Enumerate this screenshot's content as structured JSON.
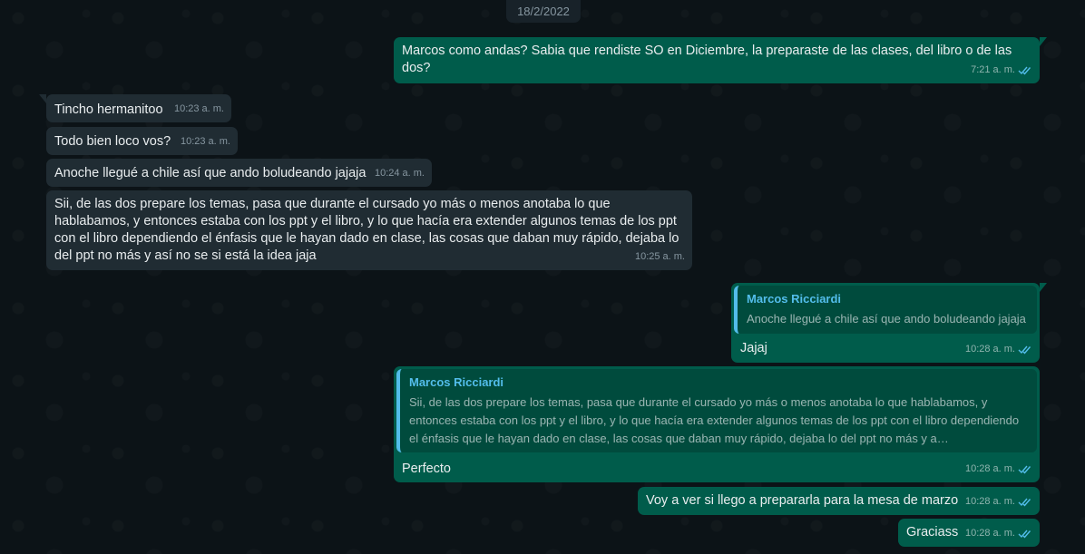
{
  "date": "18/2/2022",
  "colors": {
    "background": "#0c1317",
    "incoming_bubble": "#202c33",
    "outgoing_bubble": "#005c4b",
    "quote_accent": "#53bdeb",
    "read_ticks": "#53bdeb"
  },
  "messages": {
    "m1": {
      "text": "Marcos como andas? Sabia que rendiste SO en Diciembre, la preparaste de las clases, del libro o de las dos?",
      "time": "7:21 a. m."
    },
    "m2": {
      "text": "Tincho hermanitoo",
      "time": "10:23 a. m."
    },
    "m3": {
      "text": "Todo bien loco vos?",
      "time": "10:23 a. m."
    },
    "m4": {
      "text": "Anoche llegué a chile así que ando boludeando jajaja",
      "time": "10:24 a. m."
    },
    "m5": {
      "text": "Sii, de las dos prepare los temas, pasa que durante el cursado yo más o menos anotaba lo que hablabamos, y entonces estaba con los ppt y el libro, y lo que hacía era extender algunos temas de los ppt con el libro dependiendo el énfasis que le hayan dado en clase, las cosas que daban muy rápido, dejaba lo del ppt no más y así no se si está la idea jaja",
      "time": "10:25 a. m."
    },
    "m6": {
      "quote_author": "Marcos Ricciardi",
      "quote_text": "Anoche llegué a chile así que ando boludeando jajaja",
      "text": "Jajaj",
      "time": "10:28 a. m."
    },
    "m7": {
      "quote_author": "Marcos Ricciardi",
      "quote_text": "Sii, de las dos prepare los temas, pasa que durante el cursado yo más o menos anotaba lo que hablabamos, y entonces estaba con los ppt y el libro, y lo que hacía era extender algunos temas de los ppt con el libro dependiendo el énfasis que le hayan dado en clase, las cosas que daban muy rápido, dejaba lo del ppt no más y a…",
      "text": "Perfecto",
      "time": "10:28 a. m."
    },
    "m8": {
      "text": "Voy a ver si llego a prepararla para la mesa de marzo",
      "time": "10:28 a. m."
    },
    "m9": {
      "text": "Graciass",
      "time": "10:28 a. m."
    }
  },
  "icons": {
    "read_receipt": "double-check-icon"
  }
}
